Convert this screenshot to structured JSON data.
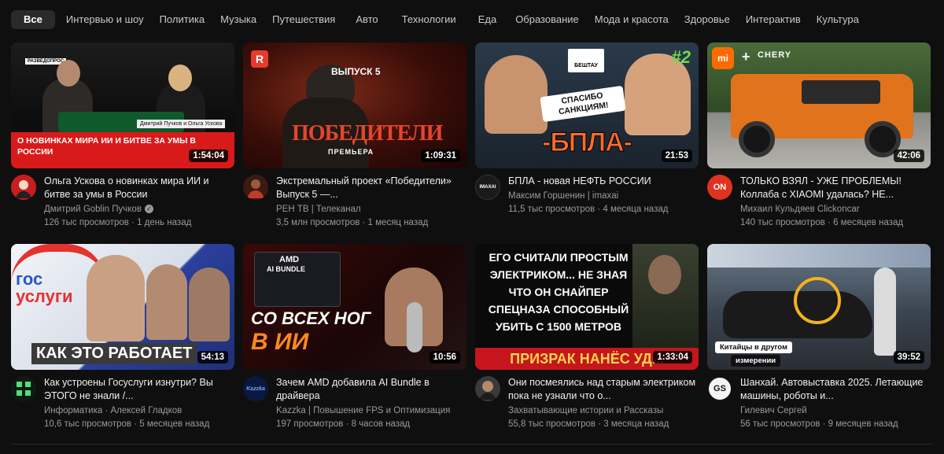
{
  "chips": [
    {
      "label": "Все",
      "active": true
    },
    {
      "label": "Интервью и шоу"
    },
    {
      "label": "Политика"
    },
    {
      "label": "Музыка"
    },
    {
      "label": "Путешествия"
    },
    {
      "label": "Авто"
    },
    {
      "label": "Технологии"
    },
    {
      "label": "Еда"
    },
    {
      "label": "Образование"
    },
    {
      "label": "Мода и красота"
    },
    {
      "label": "Здоровье"
    },
    {
      "label": "Интерактив"
    },
    {
      "label": "Культура"
    }
  ],
  "videos": [
    {
      "title": "Ольга Ускова о новинках мира ИИ и битве за умы в России",
      "channel": "Дмитрий Goblin Пучков",
      "verified": true,
      "stats": "126 тыс просмотров · 1 день назад",
      "duration": "1:54:04",
      "thumb_caption": "Дмитрий Пучков и Ольга Ускова",
      "thumb_banner": "О НОВИНКАХ МИРА ИИ И БИТВЕ ЗА УМЫ В РОССИИ",
      "thumb_logo": "РАЗВЕДОПРОС"
    },
    {
      "title": "Экстремальный проект «Победители» Выпуск 5 —...",
      "channel": "РЕН ТВ | Телеканал",
      "stats": "3,5 млн просмотров · 1 месяц назад",
      "duration": "1:09:31",
      "thumb_episode": "ВЫПУСК 5",
      "thumb_show": "ПОБЕДИТЕЛИ",
      "thumb_sub": "ПРЕМЬЕРА"
    },
    {
      "title": "БПЛА - новая НЕФТЬ РОССИИ",
      "channel": "Максим Горшенин | imaxai",
      "stats": "11,5 тыс просмотров · 4 месяца назад",
      "duration": "21:53",
      "thumb_brand": "БЕШТАУ",
      "thumb_num": "#2",
      "thumb_bubble": "СПАСИБО САНКЦИЯМ!",
      "thumb_big": "-БПЛА-",
      "avatar_text": "IMAXAI"
    },
    {
      "title": "ТОЛЬКО ВЗЯЛ - УЖЕ ПРОБЛЕМЫ! Коллаба с XIAOMI удалась? НЕ...",
      "channel": "Михаил Кульдяев Clickoncar",
      "stats": "140 тыс просмотров · 6 месяцев назад",
      "duration": "42:06",
      "thumb_brand_left": "mi",
      "thumb_brand_right": "CHERY",
      "avatar_text": "ON"
    },
    {
      "title": "Как устроены Госуслуги изнутри? Вы ЭТОГО не знали /...",
      "channel": "Информатика · Алексей Гладков",
      "stats": "10,6 тыс просмотров · 5 месяцев назад",
      "duration": "54:13",
      "thumb_logo_1": "гос",
      "thumb_logo_2": "услуги",
      "thumb_banner": "КАК ЭТО РАБОТАЕТ"
    },
    {
      "title": "Зачем AMD добавила AI Bundle в драйвера",
      "channel": "Kazzka | Повышение FPS и Оптимизация",
      "stats": "197 просмотров · 8 часов назад",
      "duration": "10:56",
      "thumb_brand": "AMD",
      "thumb_product": "AI BUNDLE",
      "thumb_line1": "СО ВСЕХ НОГ",
      "thumb_line2": "В ИИ",
      "avatar_text": "Kazzka"
    },
    {
      "title": "Они посмеялись над старым электриком пока не узнали что о...",
      "channel": "Захватывающие истории и Рассказы",
      "stats": "55,8 тыс просмотров · 3 месяца назад",
      "duration": "1:33:04",
      "thumb_headline_1": "ЕГО СЧИТАЛИ ПРОСТЫМ ЭЛЕКТРИКОМ... НЕ ЗНАЯ ЧТО ОН СНАЙПЕР СПЕЦНАЗА СПОСОБНЫЙ УБИТЬ С 1500 МЕТРОВ",
      "thumb_banner": "ПРИЗРАК НАНЁС УД..."
    },
    {
      "title": "Шанхай. Автовыставка 2025. Летающие машины, роботы и...",
      "channel": "Гилевич Сергей",
      "stats": "56 тыс просмотров · 9 месяцев назад",
      "duration": "39:52",
      "thumb_caption_1": "Китайцы в другом",
      "thumb_caption_2": "измерении",
      "avatar_text": "GS"
    }
  ]
}
